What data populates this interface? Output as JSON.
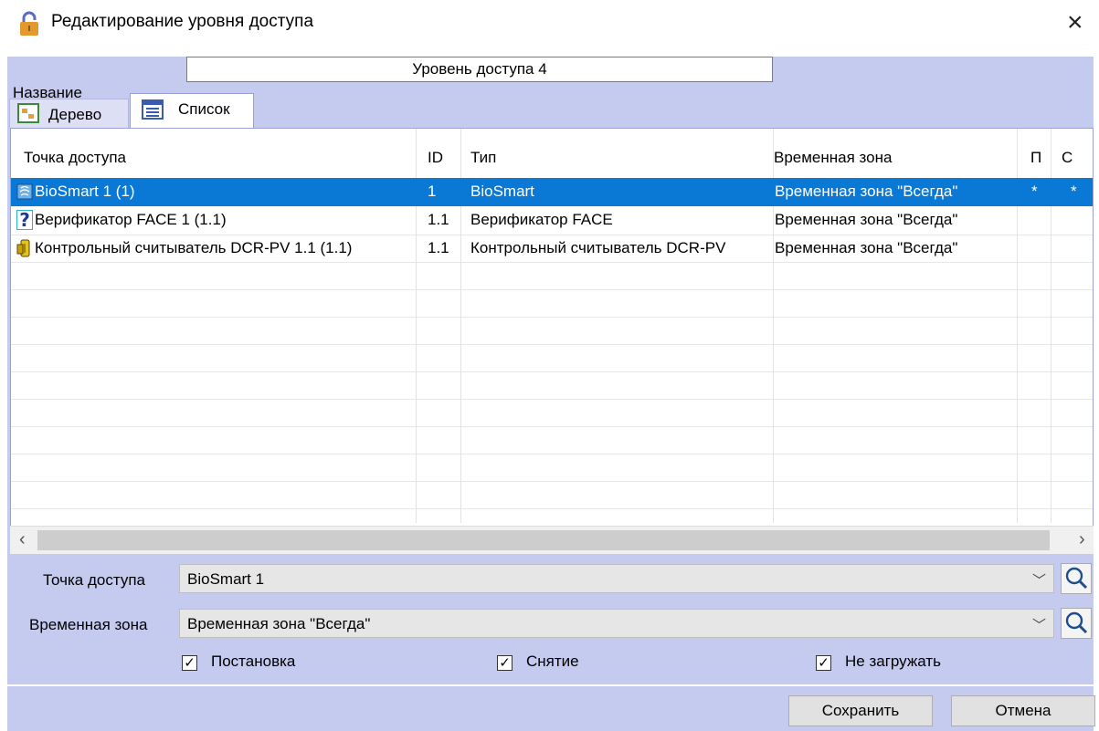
{
  "window": {
    "title": "Редактирование уровня доступа"
  },
  "name_field": {
    "label": "Название",
    "value": "Уровень доступа 4"
  },
  "tabs": [
    {
      "label": "Дерево",
      "icon": "tree-view-icon"
    },
    {
      "label": "Список",
      "icon": "list-view-icon"
    }
  ],
  "table": {
    "columns": [
      "Точка доступа",
      "ID",
      "Тип",
      "Временная зона",
      "П",
      "С"
    ],
    "rows": [
      {
        "point": "BioSmart 1 (1)",
        "id": "1",
        "type": "BioSmart",
        "zone": "Временная зона \"Всегда\"",
        "p": "*",
        "c": "*",
        "icon": "biometric-reader-icon",
        "selected": true
      },
      {
        "point": "Верификатор FACE 1 (1.1)",
        "id": "1.1",
        "type": "Верификатор FACE",
        "zone": "Временная зона \"Всегда\"",
        "p": "",
        "c": "",
        "icon": "question-icon",
        "selected": false
      },
      {
        "point": "Контрольный считыватель DCR-PV 1.1 (1.1)",
        "id": "1.1",
        "type": "Контрольный считыватель DCR-PV",
        "zone": "Временная зона \"Всегда\"",
        "p": "",
        "c": "",
        "icon": "card-reader-icon",
        "selected": false
      }
    ]
  },
  "form": {
    "access_point": {
      "label": "Точка доступа",
      "value": "BioSmart 1"
    },
    "time_zone": {
      "label": "Временная зона",
      "value": "Временная зона \"Всегда\""
    },
    "checkboxes": [
      {
        "label": "Постановка",
        "checked": true
      },
      {
        "label": "Снятие",
        "checked": true
      },
      {
        "label": "Не загружать",
        "checked": true
      }
    ]
  },
  "buttons": {
    "save": "Сохранить",
    "cancel": "Отмена"
  },
  "colors": {
    "panel": "#c5caef",
    "selection": "#0a79d6"
  }
}
